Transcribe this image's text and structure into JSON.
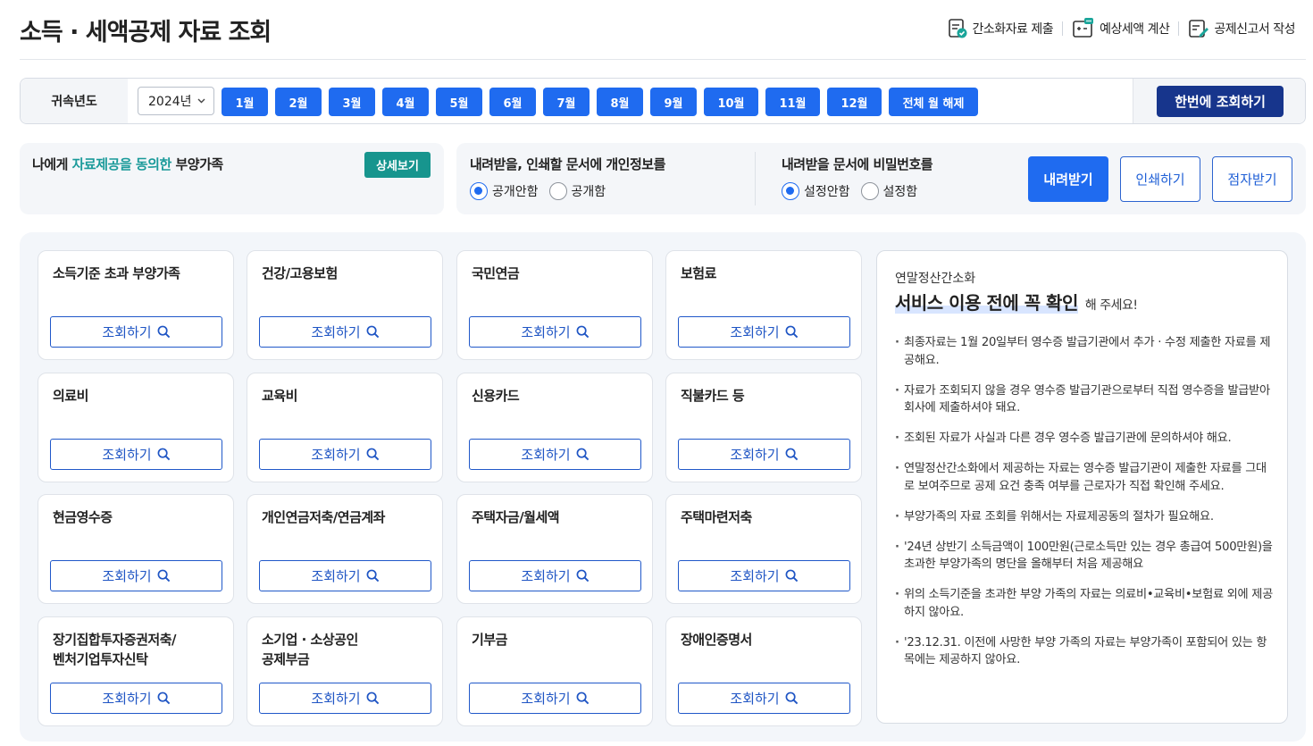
{
  "header": {
    "title": "소득 · 세액공제 자료 조회",
    "links": [
      {
        "label": "간소화자료 제출",
        "icon": "document-check-icon"
      },
      {
        "label": "예상세액 계산",
        "icon": "calculator-icon"
      },
      {
        "label": "공제신고서 작성",
        "icon": "document-edit-icon"
      }
    ]
  },
  "filter": {
    "label": "귀속년도",
    "year": "2024년",
    "months": [
      "1월",
      "2월",
      "3월",
      "4월",
      "5월",
      "6월",
      "7월",
      "8월",
      "9월",
      "10월",
      "11월",
      "12월"
    ],
    "clear_all": "전체 월 해제",
    "search_all": "한번에 조회하기"
  },
  "consent": {
    "prefix": "나에게 ",
    "highlight": "자료제공을 동의한",
    "suffix": " 부양가족",
    "detail_button": "상세보기"
  },
  "doc_options": {
    "privacy_question": "내려받을, 인쇄할 문서에 개인정보를",
    "privacy_options": [
      "공개안함",
      "공개함"
    ],
    "privacy_selected": "공개안함",
    "password_question": "내려받을 문서에 비밀번호를",
    "password_options": [
      "설정안함",
      "설정함"
    ],
    "password_selected": "설정안함",
    "download": "내려받기",
    "print": "인쇄하기",
    "braille": "점자받기"
  },
  "cards": {
    "button_label": "조회하기",
    "items": [
      "소득기준 초과 부양가족",
      "건강/고용보험",
      "국민연금",
      "보험료",
      "의료비",
      "교육비",
      "신용카드",
      "직불카드 등",
      "현금영수증",
      "개인연금저축/연금계좌",
      "주택자금/월세액",
      "주택마련저축",
      "장기집합투자증권저축/\n벤처기업투자신탁",
      "소기업 · 소상공인\n공제부금",
      "기부금",
      "장애인증명서"
    ]
  },
  "notice": {
    "subtitle": "연말정산간소화",
    "title": "서비스 이용 전에 꼭 확인",
    "title_tail": "해 주세요!",
    "items": [
      "최종자료는 1월 20일부터 영수증 발급기관에서 추가 · 수정 제출한 자료를 제공해요.",
      "자료가 조회되지 않을 경우 영수증 발급기관으로부터 직접 영수증을 발급받아 회사에 제출하셔야 돼요.",
      "조회된 자료가 사실과 다른 경우 영수증 발급기관에 문의하셔야 해요.",
      "연말정산간소화에서 제공하는 자료는 영수증 발급기관이 제출한 자료를 그대로 보여주므로 공제 요건 충족 여부를 근로자가 직접 확인해 주세요.",
      "부양가족의 자료 조회를 위해서는 자료제공동의 절차가 필요해요.",
      "'24년 상반기 소득금액이 100만원(근로소득만 있는 경우 총급여 500만원)을 초과한 부양가족의 명단을 올해부터 처음 제공해요",
      "위의 소득기준을 초과한 부양 가족의 자료는 의료비•교육비•보험료 외에 제공하지 않아요.",
      "'23.12.31. 이전에 사망한 부양 가족의 자료는 부양가족이 포함되어 있는 항목에는 제공하지 않아요."
    ]
  },
  "colors": {
    "primary": "#1f6bf0",
    "navy": "#17358c",
    "teal": "#17958e",
    "panel": "#f3f6fa"
  }
}
